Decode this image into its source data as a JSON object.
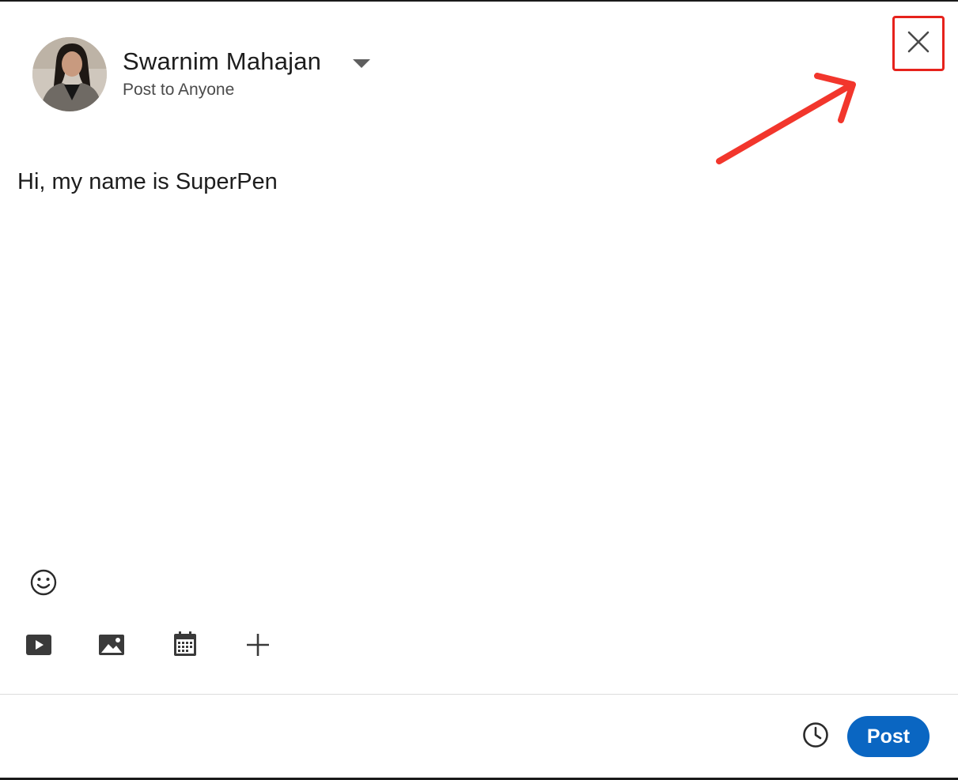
{
  "header": {
    "author_name": "Swarnim Mahajan",
    "audience": "Post to Anyone",
    "avatar_icon": "user-photo-avatar",
    "dropdown_icon": "caret-down-icon",
    "close_icon": "close-icon"
  },
  "composer": {
    "text": "Hi, my name is SuperPen"
  },
  "toolbar": {
    "emoji_icon": "smiley-icon",
    "items": [
      {
        "icon": "video-icon"
      },
      {
        "icon": "photo-icon"
      },
      {
        "icon": "calendar-event-icon"
      },
      {
        "icon": "plus-icon"
      }
    ]
  },
  "footer": {
    "schedule_icon": "clock-icon",
    "post_label": "Post"
  },
  "colors": {
    "post_button": "#0a66c2",
    "annotation": "#e6221c"
  }
}
